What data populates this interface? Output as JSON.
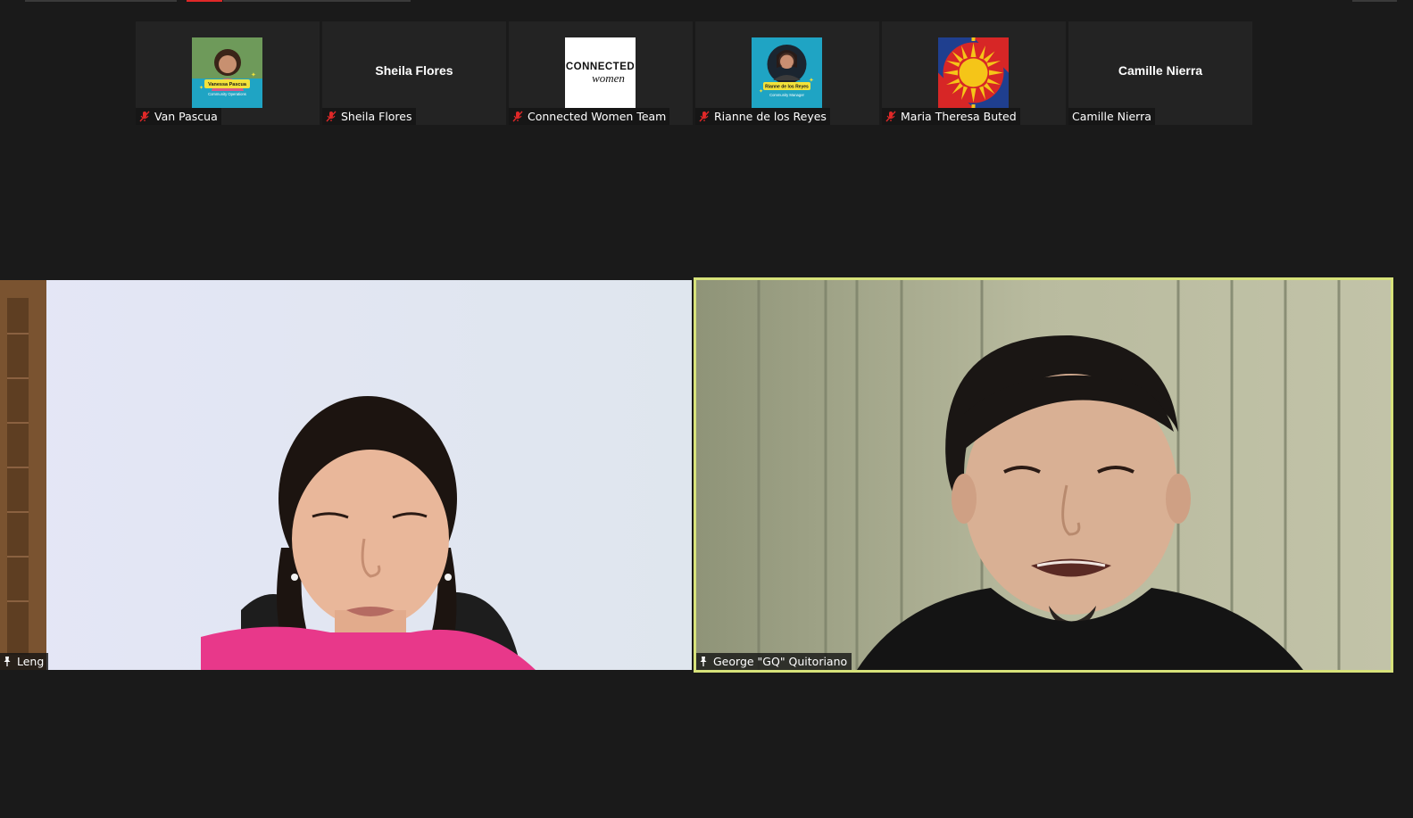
{
  "colors": {
    "background": "#1a1a1a",
    "tile_background": "#232323",
    "active_speaker_border": "#d7e27a",
    "mute_icon": "#e02828"
  },
  "gallery": {
    "participants": [
      {
        "name": "Van Pascua",
        "muted": true,
        "avatar": "profile-photo"
      },
      {
        "name": "Sheila Flores",
        "muted": true,
        "display_name": "Sheila Flores"
      },
      {
        "name": "Connected Women Team",
        "muted": true,
        "avatar": "connected-women-logo"
      },
      {
        "name": "Rianne de los Reyes",
        "muted": true,
        "avatar": "profile-photo"
      },
      {
        "name": "Maria Theresa Buted",
        "muted": true,
        "avatar": "sun-logo"
      },
      {
        "name": "Camille Nierra",
        "muted": false,
        "display_name": "Camille Nierra"
      }
    ]
  },
  "avatars": {
    "van": {
      "name_tag": "Vanessa Pascua",
      "role": "Community Operations"
    },
    "connected_women": {
      "line1": "CONNECTED",
      "line2": "women"
    },
    "rianne": {
      "name_tag": "Rianne de los Reyes",
      "role": "Community Manager"
    }
  },
  "videos": {
    "left": {
      "name": "Leng",
      "pinned": true
    },
    "right": {
      "name": "George \"GQ\" Quitoriano",
      "pinned": true,
      "active_speaker": true
    }
  }
}
